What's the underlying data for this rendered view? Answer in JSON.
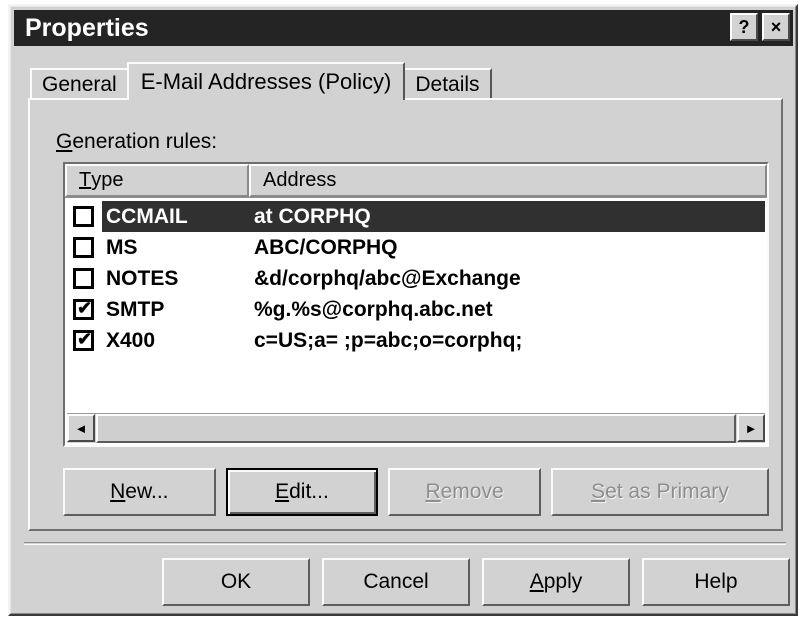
{
  "window": {
    "title": "Properties",
    "help_button": "?",
    "close_button": "×"
  },
  "tabs": [
    {
      "label": "General",
      "active": false
    },
    {
      "label": "E-Mail Addresses (Policy)",
      "active": true
    },
    {
      "label": "Details",
      "active": false
    }
  ],
  "page": {
    "rules_label_accel": "G",
    "rules_label_rest": "eneration rules:"
  },
  "list": {
    "columns": [
      {
        "accel": "T",
        "rest": "ype"
      },
      {
        "accel": "",
        "rest": "Address"
      }
    ],
    "rows": [
      {
        "checked": false,
        "type": "CCMAIL",
        "address": "at CORPHQ",
        "selected": true
      },
      {
        "checked": false,
        "type": "MS",
        "address": "ABC/CORPHQ",
        "selected": false
      },
      {
        "checked": false,
        "type": "NOTES",
        "address": "&d/corphq/abc@Exchange",
        "selected": false
      },
      {
        "checked": true,
        "type": "SMTP",
        "address": "%g.%s@corphq.abc.net",
        "selected": false
      },
      {
        "checked": true,
        "type": "X400",
        "address": "c=US;a= ;p=abc;o=corphq;",
        "selected": false
      }
    ],
    "checked_glyph": "✔",
    "scroll_left_arrow": "◄",
    "scroll_right_arrow": "►"
  },
  "actions": [
    {
      "name": "new",
      "accel": "N",
      "before": "",
      "after": "ew...",
      "state": "enabled"
    },
    {
      "name": "edit",
      "accel": "E",
      "before": "",
      "after": "dit...",
      "state": "default"
    },
    {
      "name": "remove",
      "accel": "R",
      "before": "",
      "after": "emove",
      "state": "disabled"
    },
    {
      "name": "primary",
      "accel": "S",
      "before": "",
      "after": "et as Primary",
      "state": "disabled"
    }
  ],
  "footer": [
    {
      "name": "ok",
      "accel": "",
      "before": "OK",
      "after": ""
    },
    {
      "name": "cancel",
      "accel": "",
      "before": "Cancel",
      "after": ""
    },
    {
      "name": "apply",
      "accel": "A",
      "before": "",
      "after": "pply"
    },
    {
      "name": "help",
      "accel": "",
      "before": "Help",
      "after": ""
    }
  ],
  "colors": {
    "face": "#d2d2d2",
    "titlebar": "#242424",
    "selection": "#303030",
    "list_background": "#ffffff",
    "disabled_text": "#8e8e8e"
  }
}
